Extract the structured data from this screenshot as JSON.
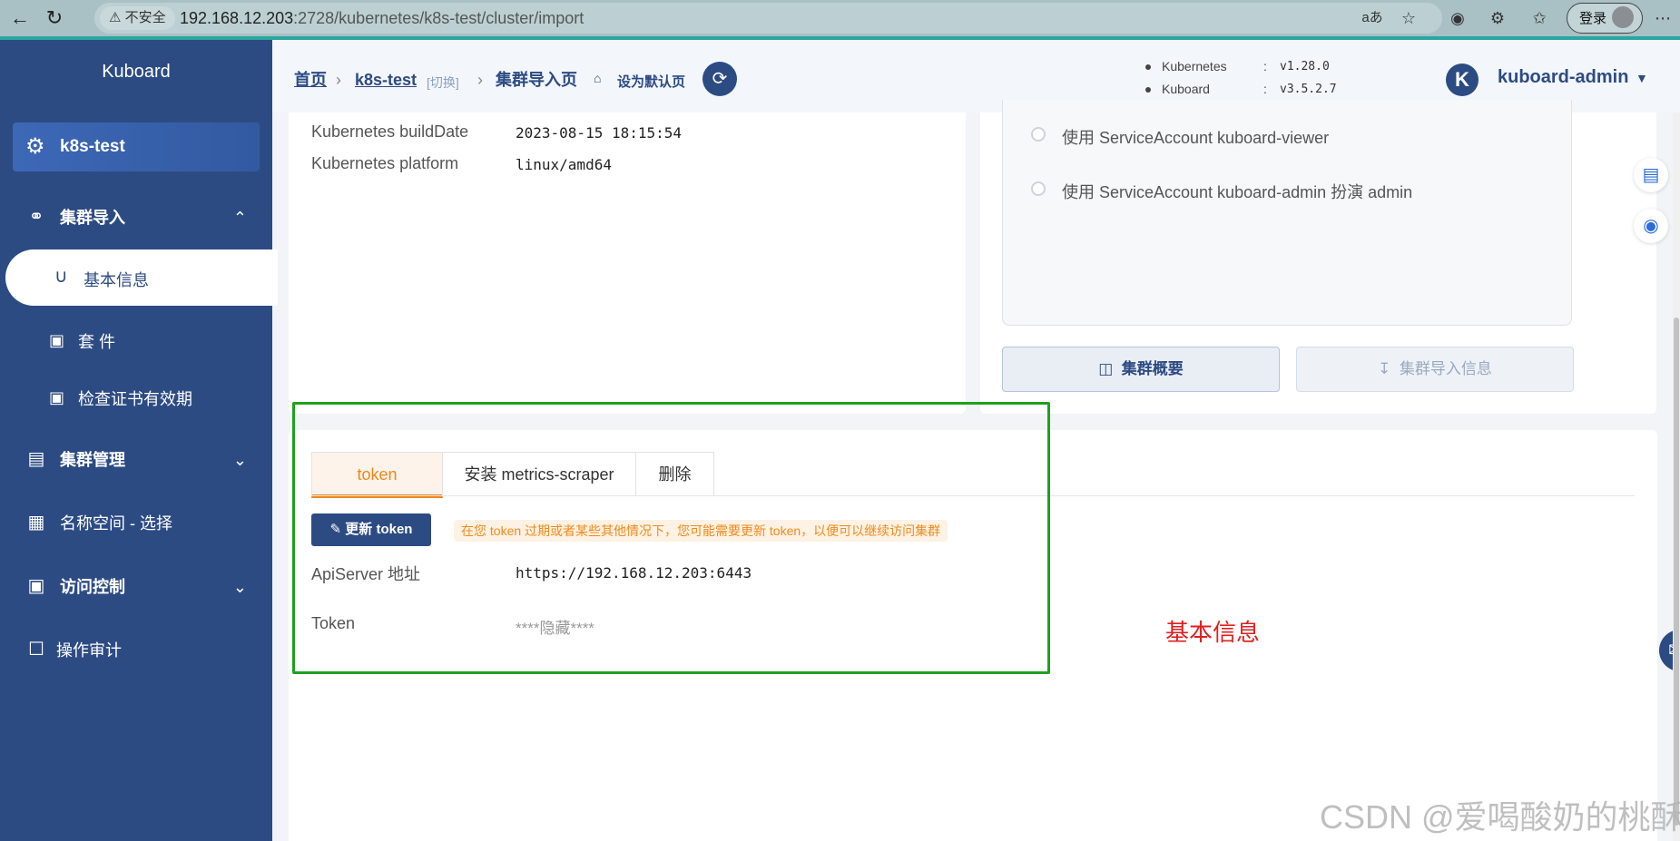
{
  "browser": {
    "security": "不安全",
    "url_host": "192.168.12.203",
    "url_rest": ":2728/kubernetes/k8s-test/cluster/import",
    "login_label": "登录",
    "icons": [
      "back-icon",
      "reload-icon",
      "warning-icon",
      "read-aloud-icon",
      "star-icon",
      "extensions-icon",
      "favorites-icon",
      "more-icon"
    ]
  },
  "sidebar": {
    "brand": "Kuboard",
    "cluster_name": "k8s-test",
    "menu": {
      "cluster_import": "集群导入",
      "basic_info": "基本信息",
      "suite": "套 件",
      "check_cert": "检查证书有效期",
      "cluster_manage": "集群管理",
      "namespace": "名称空间 - 选择",
      "access_control": "访问控制",
      "audit": "操作审计"
    },
    "colors": {
      "background": "#2d4b83",
      "active": "#ffffff"
    }
  },
  "header": {
    "breadcrumb": {
      "home": "首页",
      "cluster": "k8s-test",
      "switch": "[切换]",
      "page": "集群导入页"
    },
    "set_default": "设为默认页",
    "versions": {
      "k8s_label": "Kubernetes",
      "k8s_value": "v1.28.0",
      "kuboard_label": "Kuboard",
      "kuboard_value": "v3.5.2.7",
      "colon": ":"
    },
    "user": {
      "avatar_letter": "K",
      "name": "kuboard-admin"
    }
  },
  "info": {
    "build_date_label": "Kubernetes buildDate",
    "build_date_value": "2023-08-15 18:15:54",
    "platform_label": "Kubernetes platform",
    "platform_value": "linux/amd64"
  },
  "access": {
    "options": [
      "使用 ServiceAccount kuboard-viewer",
      "使用 ServiceAccount kuboard-admin 扮演 admin"
    ],
    "overview_button": "集群概要",
    "import_info_button": "集群导入信息"
  },
  "tabs": {
    "items": [
      "token",
      "安装 metrics-scraper",
      "删除"
    ],
    "active_index": 0
  },
  "token_panel": {
    "update_button": "更新 token",
    "tip": "在您 token 过期或者某些其他情况下，您可能需要更新 token，以便可以继续访问集群",
    "apiserver_label": "ApiServer 地址",
    "apiserver_value": "https://192.168.12.203:6443",
    "token_label": "Token",
    "token_value": "****隐藏****"
  },
  "annotation": {
    "text": "基本信息",
    "box_color": "#1ea11e",
    "text_color": "#e02020"
  },
  "watermark": "CSDN @爱喝酸奶的桃酥"
}
